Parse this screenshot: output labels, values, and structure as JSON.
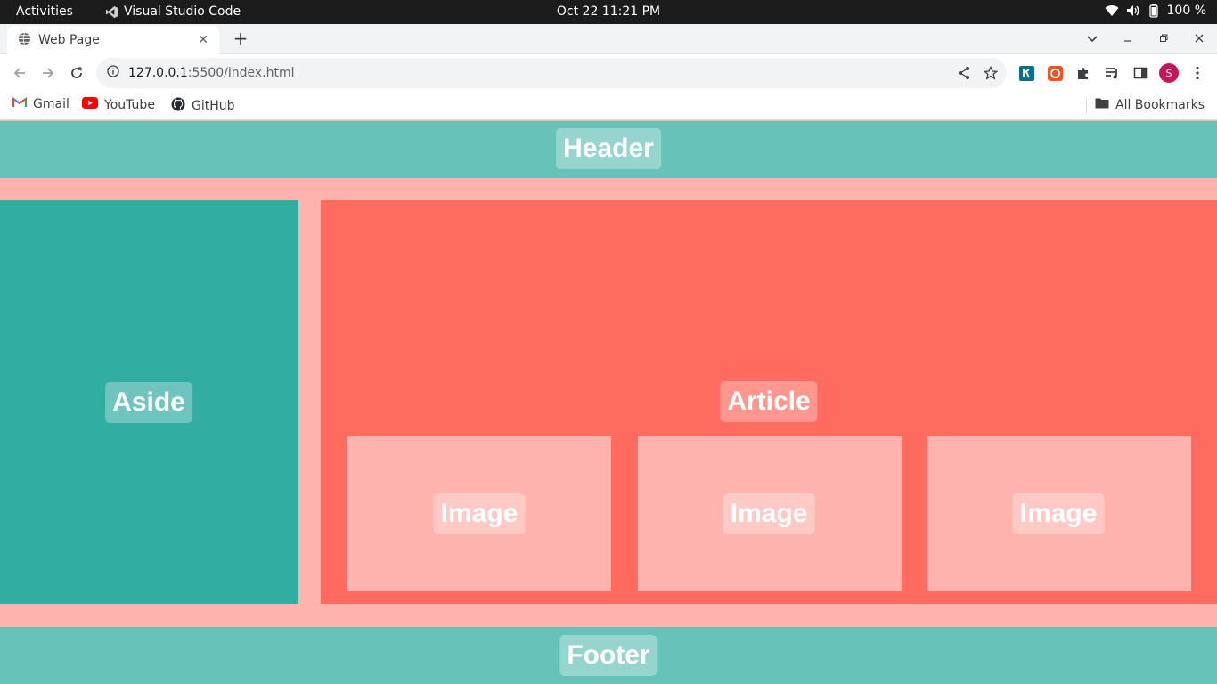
{
  "system_bar": {
    "activities": "Activities",
    "app_name": "Visual Studio Code",
    "datetime": "Oct 22  11:21 PM",
    "battery": "100 %"
  },
  "browser": {
    "tab_title": "Web Page",
    "new_tab": "+",
    "url_host": "127.0.0.1",
    "url_path": ":5500/index.html",
    "profile_initial": "S",
    "bookmarks": [
      {
        "label": "Gmail",
        "icon": "gmail-icon"
      },
      {
        "label": "YouTube",
        "icon": "youtube-icon"
      },
      {
        "label": "GitHub",
        "icon": "github-icon"
      }
    ],
    "all_bookmarks": "All Bookmarks"
  },
  "page": {
    "header": "Header",
    "aside": "Aside",
    "article": "Article",
    "images": [
      "Image",
      "Image",
      "Image"
    ],
    "footer": "Footer"
  },
  "colors": {
    "background": "#ffb3ae",
    "header_footer": "#67c3b9",
    "aside": "#31ada2",
    "article": "#ff6b5f",
    "image": "#ffb3ae"
  }
}
